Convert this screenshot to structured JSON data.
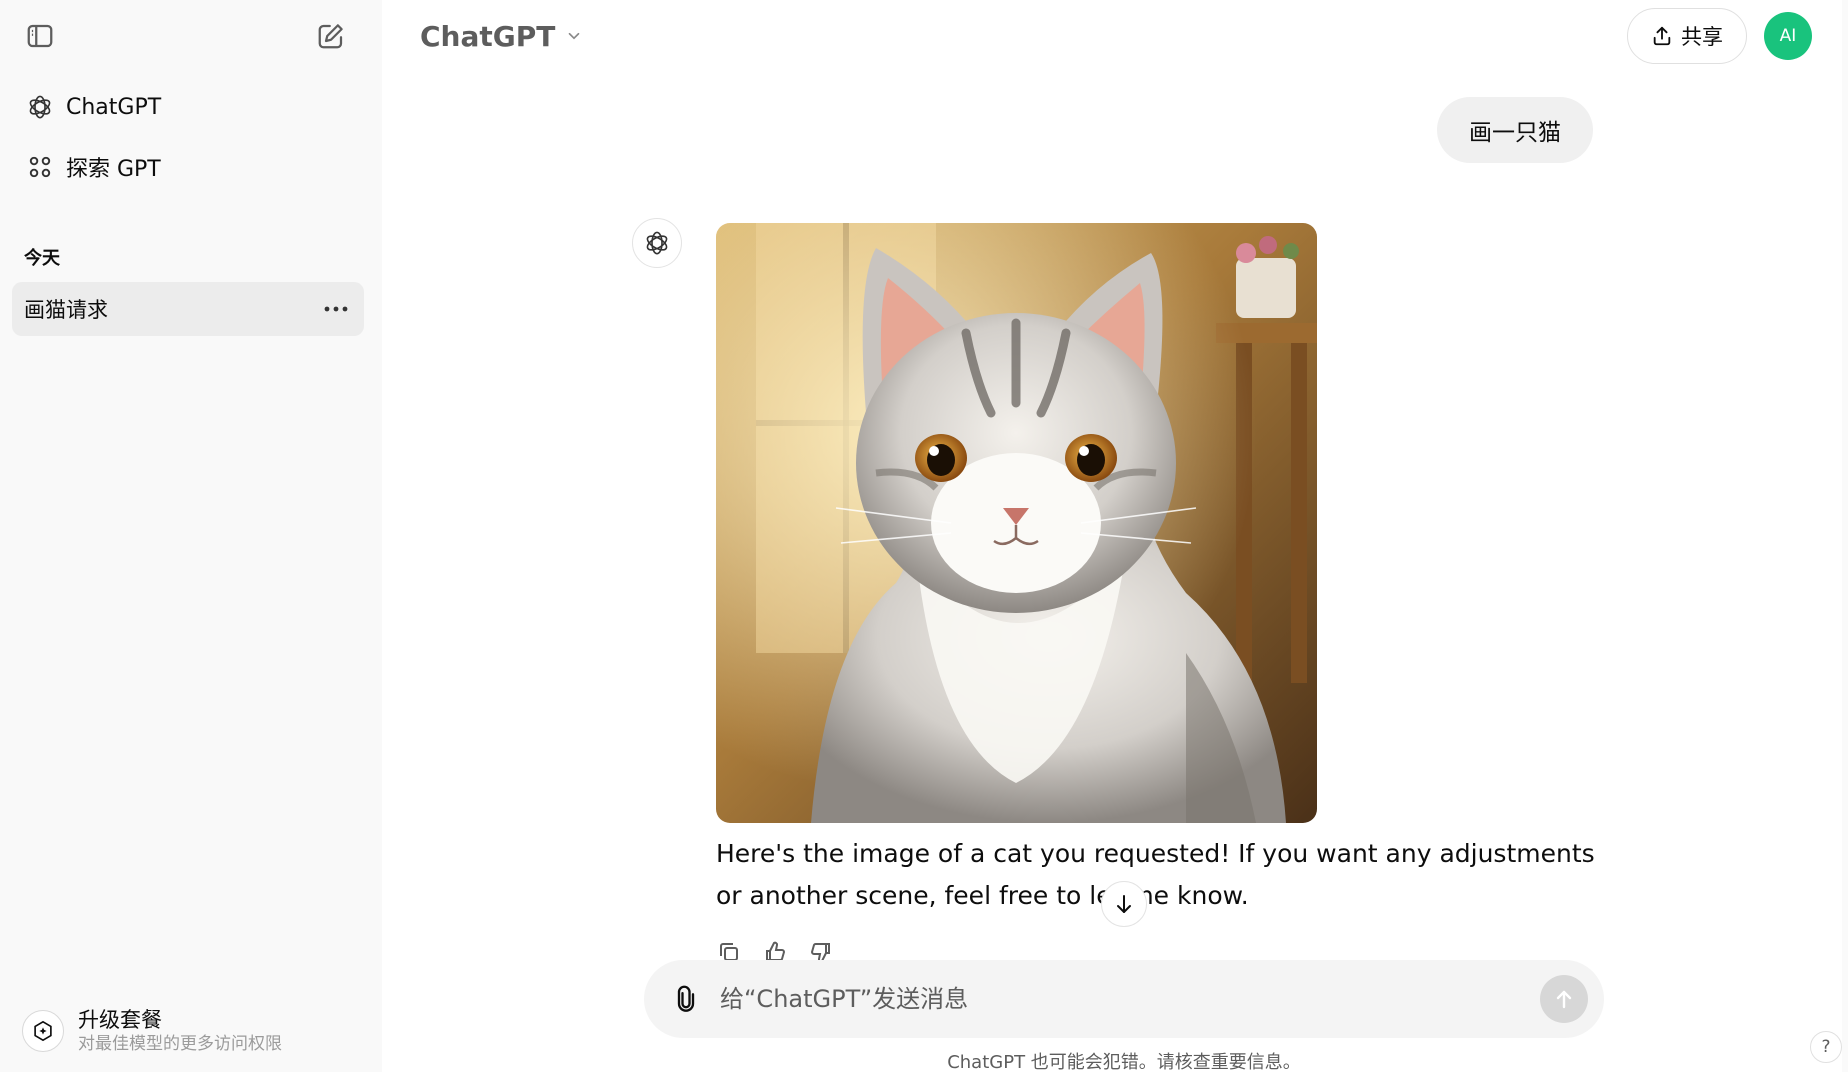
{
  "sidebar": {
    "items": [
      {
        "label": "ChatGPT",
        "icon": "openai-logo-icon"
      },
      {
        "label": "探索 GPT",
        "icon": "grid-dots-icon"
      }
    ],
    "section_today": "今天",
    "history": [
      {
        "title": "画猫请求"
      }
    ],
    "upgrade": {
      "title": "升级套餐",
      "subtitle": "对最佳模型的更多访问权限"
    }
  },
  "header": {
    "model_name": "ChatGPT",
    "share_label": "共享",
    "avatar_initials": "AI"
  },
  "conversation": {
    "user_message": "画一只猫",
    "assistant_reply": "Here's the image of a cat you requested! If you want any adjustments or another scene, feel free to let me know."
  },
  "composer": {
    "placeholder": "给“ChatGPT”发送消息"
  },
  "footer": {
    "disclaimer": "ChatGPT 也可能会犯错。请核查重要信息。",
    "help_label": "?"
  },
  "colors": {
    "sidebar_bg": "#f9f9f9",
    "avatar_bg": "#19c37d",
    "bubble_bg": "#f0f0f0",
    "composer_bg": "#f4f4f4"
  }
}
